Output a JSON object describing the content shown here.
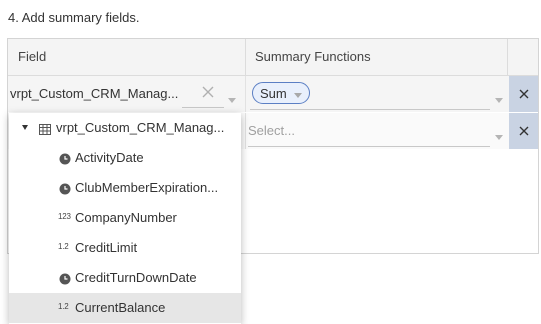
{
  "step": {
    "title": "4. Add summary fields."
  },
  "table": {
    "headers": {
      "field": "Field",
      "functions": "Summary Functions"
    },
    "rows": [
      {
        "field": "vrpt_Custom_CRM_Manag...",
        "function_tag": "Sum"
      },
      {
        "field": "",
        "function_placeholder": "Select..."
      }
    ]
  },
  "dropdown": {
    "root": "vrpt_Custom_CRM_Manag...",
    "items": [
      {
        "label": "ActivityDate",
        "type": "clock-icon",
        "badge": ""
      },
      {
        "label": "ClubMemberExpiration...",
        "type": "clock-icon",
        "badge": ""
      },
      {
        "label": "CompanyNumber",
        "type": "integer-icon",
        "badge": "123"
      },
      {
        "label": "CreditLimit",
        "type": "decimal-icon",
        "badge": "1.2"
      },
      {
        "label": "CreditTurnDownDate",
        "type": "clock-icon",
        "badge": ""
      },
      {
        "label": "CurrentBalance",
        "type": "decimal-icon",
        "badge": "1.2"
      }
    ],
    "highlighted_index": 5
  },
  "colors": {
    "accent": "#5b7fc4",
    "tag_bg": "#e9f0fc",
    "delete_bg": "#c9d3e3",
    "highlight": "#e6e6e6"
  }
}
